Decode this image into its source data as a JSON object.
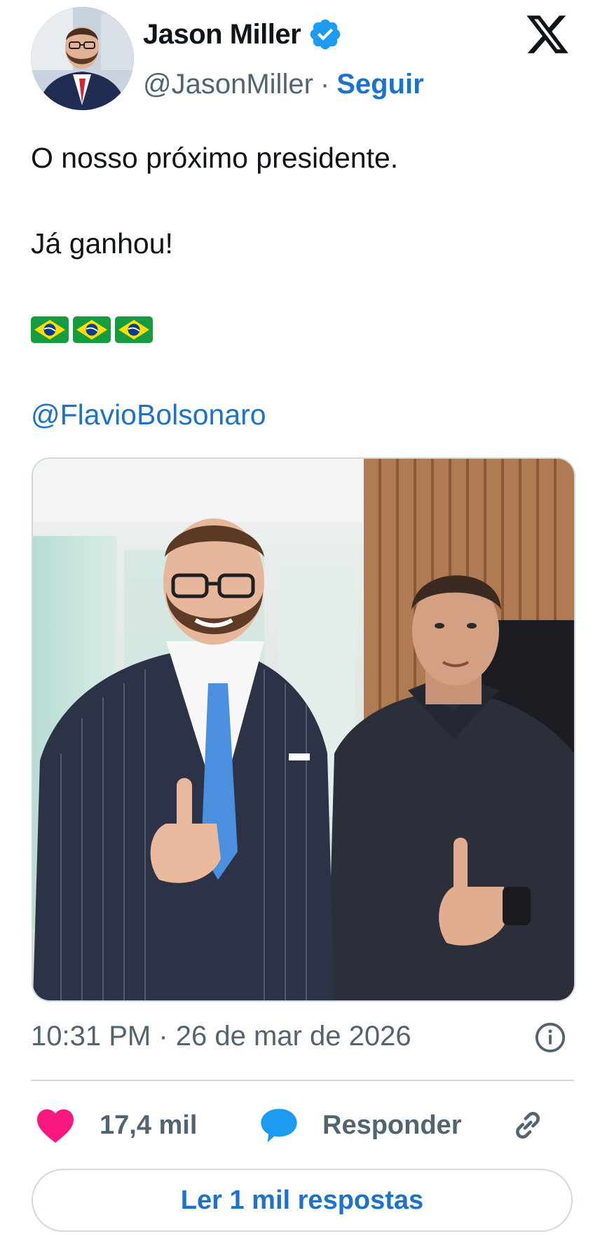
{
  "author": {
    "display_name": "Jason Miller",
    "handle": "@JasonMiller",
    "separator": "·",
    "follow_label": "Seguir",
    "verified": true,
    "avatar_icon": "profile-photo"
  },
  "platform": {
    "logo": "x-logo"
  },
  "tweet": {
    "line1": "O nosso próximo presidente.",
    "line2": "Já ganhou!",
    "flags": [
      "🇧🇷",
      "🇧🇷",
      "🇧🇷"
    ],
    "mention": "@FlavioBolsonaro"
  },
  "media": {
    "type": "photo",
    "icon": "photo-two-men-thumbs-up"
  },
  "meta": {
    "timestamp": "10:31 PM · 26 de mar de 2026",
    "info_icon": "info-icon"
  },
  "actions": {
    "likes": "17,4 mil",
    "reply_label": "Responder",
    "like_icon": "heart-icon",
    "reply_icon": "speech-bubble-icon",
    "link_icon": "link-icon"
  },
  "read_replies_label": "Ler 1 mil respostas",
  "colors": {
    "accent": "#1d73c9",
    "verified": "#1d9bf0",
    "heart": "#f91880",
    "muted": "#536471",
    "text": "#0f1419",
    "border": "#cfd9de"
  }
}
